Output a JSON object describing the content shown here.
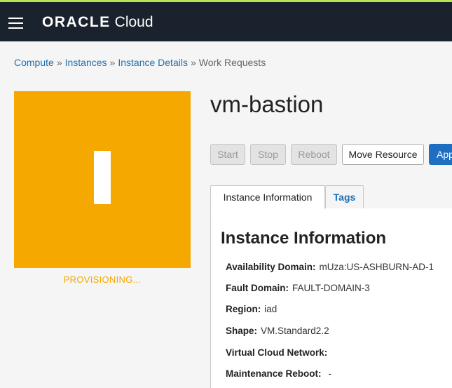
{
  "header": {
    "logo_oracle": "ORACLE",
    "logo_cloud": "Cloud"
  },
  "breadcrumb": {
    "items": [
      "Compute",
      "Instances",
      "Instance Details"
    ],
    "separator": "»",
    "current": "Work Requests"
  },
  "instance": {
    "name": "vm-bastion",
    "status": "PROVISIONING...",
    "status_color": "#f5a800"
  },
  "actions": {
    "start": "Start",
    "stop": "Stop",
    "reboot": "Reboot",
    "move_resource": "Move Resource",
    "apply_truncated": "App"
  },
  "tabs": {
    "instance_info": "Instance Information",
    "tags": "Tags"
  },
  "panel": {
    "title": "Instance Information",
    "rows": [
      {
        "label": "Availability Domain:",
        "value": "mUza:US-ASHBURN-AD-1"
      },
      {
        "label": "Fault Domain:",
        "value": "FAULT-DOMAIN-3"
      },
      {
        "label": "Region:",
        "value": "iad"
      },
      {
        "label": "Shape:",
        "value": "VM.Standard2.2"
      },
      {
        "label": "Virtual Cloud Network:",
        "value": ""
      },
      {
        "label": "Maintenance Reboot:",
        "value": "-"
      }
    ]
  },
  "colors": {
    "topbar": "#1a232d",
    "accent_stripe": "#b5e550",
    "link": "#1f6fb2",
    "primary_button": "#1e6fc1"
  },
  "icons": {
    "menu": "hamburger-menu-icon"
  }
}
